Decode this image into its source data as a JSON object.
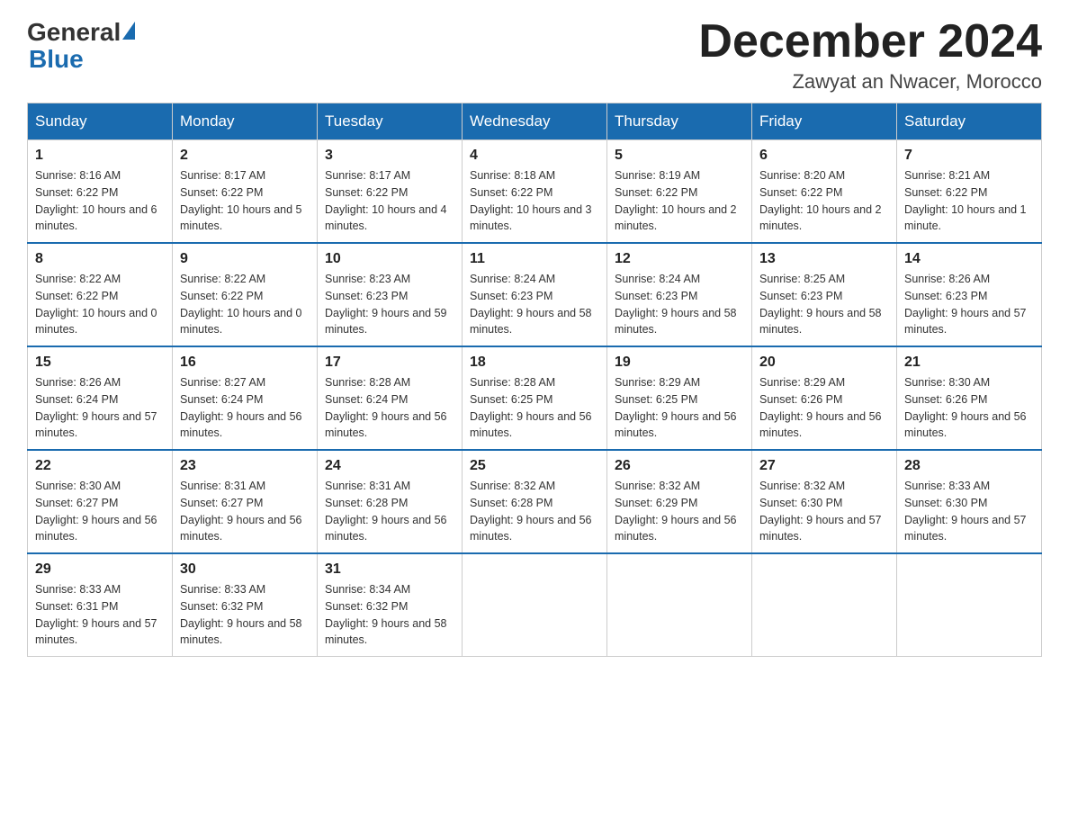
{
  "header": {
    "logo_text_general": "General",
    "logo_text_blue": "Blue",
    "month_title": "December 2024",
    "location": "Zawyat an Nwacer, Morocco"
  },
  "days_of_week": [
    "Sunday",
    "Monday",
    "Tuesday",
    "Wednesday",
    "Thursday",
    "Friday",
    "Saturday"
  ],
  "weeks": [
    [
      {
        "day": "1",
        "sunrise": "Sunrise: 8:16 AM",
        "sunset": "Sunset: 6:22 PM",
        "daylight": "Daylight: 10 hours and 6 minutes."
      },
      {
        "day": "2",
        "sunrise": "Sunrise: 8:17 AM",
        "sunset": "Sunset: 6:22 PM",
        "daylight": "Daylight: 10 hours and 5 minutes."
      },
      {
        "day": "3",
        "sunrise": "Sunrise: 8:17 AM",
        "sunset": "Sunset: 6:22 PM",
        "daylight": "Daylight: 10 hours and 4 minutes."
      },
      {
        "day": "4",
        "sunrise": "Sunrise: 8:18 AM",
        "sunset": "Sunset: 6:22 PM",
        "daylight": "Daylight: 10 hours and 3 minutes."
      },
      {
        "day": "5",
        "sunrise": "Sunrise: 8:19 AM",
        "sunset": "Sunset: 6:22 PM",
        "daylight": "Daylight: 10 hours and 2 minutes."
      },
      {
        "day": "6",
        "sunrise": "Sunrise: 8:20 AM",
        "sunset": "Sunset: 6:22 PM",
        "daylight": "Daylight: 10 hours and 2 minutes."
      },
      {
        "day": "7",
        "sunrise": "Sunrise: 8:21 AM",
        "sunset": "Sunset: 6:22 PM",
        "daylight": "Daylight: 10 hours and 1 minute."
      }
    ],
    [
      {
        "day": "8",
        "sunrise": "Sunrise: 8:22 AM",
        "sunset": "Sunset: 6:22 PM",
        "daylight": "Daylight: 10 hours and 0 minutes."
      },
      {
        "day": "9",
        "sunrise": "Sunrise: 8:22 AM",
        "sunset": "Sunset: 6:22 PM",
        "daylight": "Daylight: 10 hours and 0 minutes."
      },
      {
        "day": "10",
        "sunrise": "Sunrise: 8:23 AM",
        "sunset": "Sunset: 6:23 PM",
        "daylight": "Daylight: 9 hours and 59 minutes."
      },
      {
        "day": "11",
        "sunrise": "Sunrise: 8:24 AM",
        "sunset": "Sunset: 6:23 PM",
        "daylight": "Daylight: 9 hours and 58 minutes."
      },
      {
        "day": "12",
        "sunrise": "Sunrise: 8:24 AM",
        "sunset": "Sunset: 6:23 PM",
        "daylight": "Daylight: 9 hours and 58 minutes."
      },
      {
        "day": "13",
        "sunrise": "Sunrise: 8:25 AM",
        "sunset": "Sunset: 6:23 PM",
        "daylight": "Daylight: 9 hours and 58 minutes."
      },
      {
        "day": "14",
        "sunrise": "Sunrise: 8:26 AM",
        "sunset": "Sunset: 6:23 PM",
        "daylight": "Daylight: 9 hours and 57 minutes."
      }
    ],
    [
      {
        "day": "15",
        "sunrise": "Sunrise: 8:26 AM",
        "sunset": "Sunset: 6:24 PM",
        "daylight": "Daylight: 9 hours and 57 minutes."
      },
      {
        "day": "16",
        "sunrise": "Sunrise: 8:27 AM",
        "sunset": "Sunset: 6:24 PM",
        "daylight": "Daylight: 9 hours and 56 minutes."
      },
      {
        "day": "17",
        "sunrise": "Sunrise: 8:28 AM",
        "sunset": "Sunset: 6:24 PM",
        "daylight": "Daylight: 9 hours and 56 minutes."
      },
      {
        "day": "18",
        "sunrise": "Sunrise: 8:28 AM",
        "sunset": "Sunset: 6:25 PM",
        "daylight": "Daylight: 9 hours and 56 minutes."
      },
      {
        "day": "19",
        "sunrise": "Sunrise: 8:29 AM",
        "sunset": "Sunset: 6:25 PM",
        "daylight": "Daylight: 9 hours and 56 minutes."
      },
      {
        "day": "20",
        "sunrise": "Sunrise: 8:29 AM",
        "sunset": "Sunset: 6:26 PM",
        "daylight": "Daylight: 9 hours and 56 minutes."
      },
      {
        "day": "21",
        "sunrise": "Sunrise: 8:30 AM",
        "sunset": "Sunset: 6:26 PM",
        "daylight": "Daylight: 9 hours and 56 minutes."
      }
    ],
    [
      {
        "day": "22",
        "sunrise": "Sunrise: 8:30 AM",
        "sunset": "Sunset: 6:27 PM",
        "daylight": "Daylight: 9 hours and 56 minutes."
      },
      {
        "day": "23",
        "sunrise": "Sunrise: 8:31 AM",
        "sunset": "Sunset: 6:27 PM",
        "daylight": "Daylight: 9 hours and 56 minutes."
      },
      {
        "day": "24",
        "sunrise": "Sunrise: 8:31 AM",
        "sunset": "Sunset: 6:28 PM",
        "daylight": "Daylight: 9 hours and 56 minutes."
      },
      {
        "day": "25",
        "sunrise": "Sunrise: 8:32 AM",
        "sunset": "Sunset: 6:28 PM",
        "daylight": "Daylight: 9 hours and 56 minutes."
      },
      {
        "day": "26",
        "sunrise": "Sunrise: 8:32 AM",
        "sunset": "Sunset: 6:29 PM",
        "daylight": "Daylight: 9 hours and 56 minutes."
      },
      {
        "day": "27",
        "sunrise": "Sunrise: 8:32 AM",
        "sunset": "Sunset: 6:30 PM",
        "daylight": "Daylight: 9 hours and 57 minutes."
      },
      {
        "day": "28",
        "sunrise": "Sunrise: 8:33 AM",
        "sunset": "Sunset: 6:30 PM",
        "daylight": "Daylight: 9 hours and 57 minutes."
      }
    ],
    [
      {
        "day": "29",
        "sunrise": "Sunrise: 8:33 AM",
        "sunset": "Sunset: 6:31 PM",
        "daylight": "Daylight: 9 hours and 57 minutes."
      },
      {
        "day": "30",
        "sunrise": "Sunrise: 8:33 AM",
        "sunset": "Sunset: 6:32 PM",
        "daylight": "Daylight: 9 hours and 58 minutes."
      },
      {
        "day": "31",
        "sunrise": "Sunrise: 8:34 AM",
        "sunset": "Sunset: 6:32 PM",
        "daylight": "Daylight: 9 hours and 58 minutes."
      },
      null,
      null,
      null,
      null
    ]
  ]
}
